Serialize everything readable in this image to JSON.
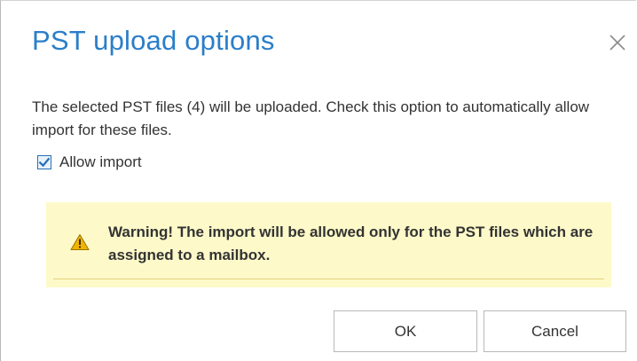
{
  "dialog": {
    "title": "PST upload options",
    "close_icon": "close-icon",
    "message": "The selected PST files (4) will be uploaded. Check this option to automatically allow import for these files.",
    "allow_import": {
      "label": "Allow import",
      "checked": true
    },
    "warning": {
      "icon": "warning-icon",
      "text": "Warning! The import will be allowed only for the PST files which are assigned to a mailbox."
    },
    "buttons": {
      "ok_label": "OK",
      "cancel_label": "Cancel"
    }
  },
  "colors": {
    "title": "#2a7ec9",
    "text": "#333333",
    "checkbox_border": "#2a6fb7",
    "warning_background": "#fdf9c9",
    "warning_rule": "#e5d27a",
    "warning_icon": "#f0b400",
    "button_border": "#b9b9b9"
  }
}
